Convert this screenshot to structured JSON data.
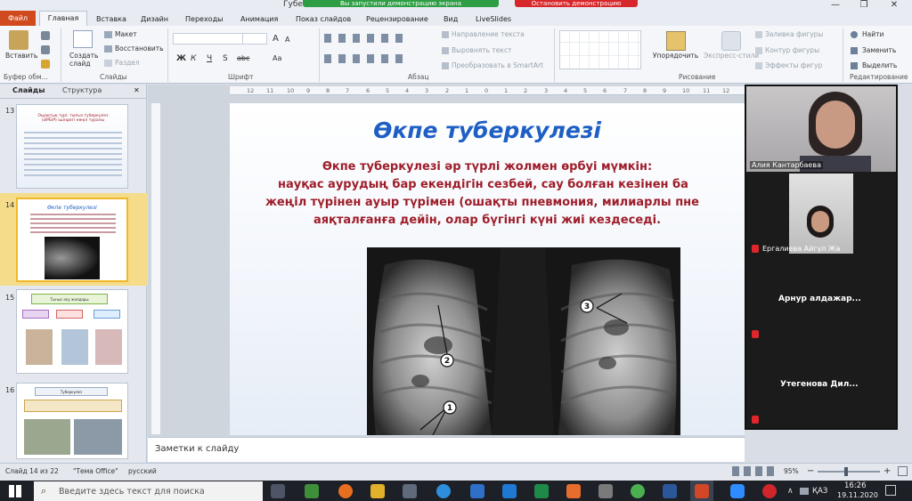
{
  "titlebar": {
    "title": "Губе",
    "demo_notice": "Вы запустили демонстрацию экрана",
    "stop_demo": "Остановить демонстрацию",
    "minimize": "—",
    "restore": "❐",
    "close": "✕"
  },
  "tabs": [
    "Файл",
    "Главная",
    "Вставка",
    "Дизайн",
    "Переходы",
    "Анимация",
    "Показ слайдов",
    "Рецензирование",
    "Вид",
    "LiveSlides"
  ],
  "ribbon": {
    "paste": "Вставить",
    "new_slide": "Создать слайд",
    "layout": "Макет",
    "reset": "Восстановить",
    "section": "Раздел",
    "text_direction": "Направление текста",
    "align_text": "Выровнять текст",
    "smartart": "Преобразовать в SmartArt",
    "arrange": "Упорядочить",
    "quick_styles": "Экспресс-стили",
    "shape_fill": "Заливка фигуры",
    "shape_outline": "Контур фигуры",
    "shape_effects": "Эффекты фигур",
    "find": "Найти",
    "replace": "Заменить",
    "select": "Выделить",
    "groups": {
      "clipboard": "Буфер обм...",
      "slides": "Слайды",
      "font": "Шрифт",
      "paragraph": "Абзац",
      "drawing": "Рисование",
      "editing": "Редактирование"
    },
    "font_bold": "Ж",
    "font_italic": "К",
    "font_underline": "Ч",
    "font_strike": "S",
    "font_spacing": "abc",
    "font_case": "Аа",
    "font_grow": "A",
    "font_shrink": "A"
  },
  "left_pane": {
    "tab_slides": "Слайды",
    "tab_outline": "Структура",
    "close": "✕",
    "slide_numbers": [
      "13",
      "14",
      "15",
      "16"
    ],
    "slide13_title": "Ошақтық түрі: тығыз туберкулез (ӘРБІР) ішіндегі көңіл туралы",
    "slide14_title": "Өкпе туберкулезі",
    "slide15_title": "Тыныс алу жолдары",
    "slide16_title": "Туберкулез"
  },
  "slide": {
    "title": "Өкпе туберкулезі",
    "line1": "Өкпе туберкулезі әр түрлі жолмен өрбуі мүмкін:",
    "line2": "науқас аурудың бар екендігін сезбей, сау болған кезінен ба",
    "line3": "жеңіл түрінен ауыр түрімен (ошақты пневмония, милиарлы пне",
    "line4": "аяқталғанға дейін, олар бүгінгі күні жиі кездеседі.",
    "markers": [
      "1",
      "2",
      "3"
    ]
  },
  "ruler_labels": [
    "12",
    "11",
    "10",
    "9",
    "8",
    "7",
    "6",
    "5",
    "4",
    "3",
    "2",
    "1",
    "0",
    "1",
    "2",
    "3",
    "4",
    "5",
    "6",
    "7",
    "8",
    "9",
    "10",
    "11",
    "12"
  ],
  "notes": {
    "placeholder": "Заметки к слайду"
  },
  "zoom": {
    "participants": [
      {
        "name": "Алия Кантарбаева"
      },
      {
        "name": "Ергалиева Айгүл Жа"
      },
      {
        "name": "Арнур алдажар..."
      },
      {
        "name": "Утегенова Дил..."
      }
    ]
  },
  "statusbar": {
    "slide_info": "Слайд 14 из 22",
    "theme": "\"Тема Office\"",
    "language": "русский",
    "zoom_level": "95%",
    "minus": "−",
    "plus": "+"
  },
  "taskbar": {
    "search_placeholder": "Введите здесь текст для поиска",
    "language": "ҚАЗ",
    "time": "16:26",
    "date": "19.11.2020"
  },
  "colors": {
    "file_tab": "#d04a1e",
    "slide_title": "#1f5fc4",
    "slide_body": "#9e1d2a",
    "demo_green": "#2e9e44",
    "demo_red": "#d8272b"
  }
}
